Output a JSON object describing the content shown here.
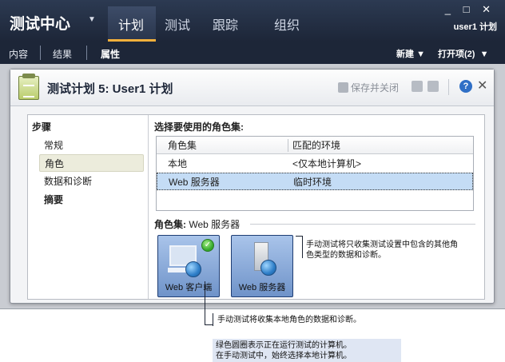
{
  "app": {
    "title": "测试中心",
    "nav_tabs": [
      "计划",
      "测试",
      "跟踪",
      "组织"
    ],
    "active_tab": "计划",
    "window_controls": "_ □ ✕",
    "user": "user1 计划"
  },
  "subnav": {
    "items": [
      "内容",
      "结果",
      "属性"
    ],
    "active": "属性",
    "new_label": "新建",
    "open_items_label": "打开项(2)"
  },
  "dialog": {
    "title": "测试计划 5: User1 计划",
    "save_close_label": "保存并关闭",
    "help_glyph": "?",
    "close_glyph": "✕",
    "steps_heading": "步骤",
    "steps": [
      "常规",
      "角色",
      "数据和诊断",
      "摘要"
    ],
    "selected_step": "角色",
    "roleset_prompt": "选择要使用的角色集:",
    "table": {
      "headers": [
        "角色集",
        "匹配的环境"
      ],
      "rows": [
        [
          "本地",
          "<仅本地计算机>"
        ],
        [
          "Web 服务器",
          "临时环境"
        ]
      ],
      "selected_row": 1
    },
    "roleset_label": "角色集:",
    "roleset_value": "Web 服务器",
    "tiles": [
      "Web 客户端",
      "Web 服务器"
    ]
  },
  "callouts": {
    "server_note": "手动测试将只收集测试设置中包含的其他角色类型的数据和诊断。",
    "local_note": "手动测试将收集本地角色的数据和诊断。",
    "green_note_1": "绿色圆圈表示正在运行测试的计算机。",
    "green_note_2": "在手动测试中，始终选择本地计算机。"
  },
  "colors": {
    "appbar": "#2c3a52",
    "accent_tab": "#f3b03b",
    "selection": "#c4dcf5",
    "tile": "#6f93c9",
    "running": "#33a82a"
  }
}
